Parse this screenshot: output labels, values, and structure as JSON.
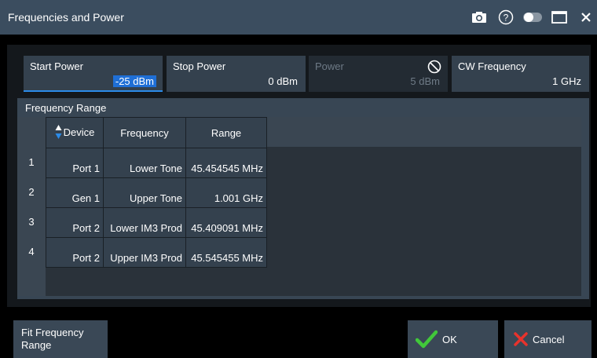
{
  "window": {
    "title": "Frequencies and Power"
  },
  "titlebar_icons": [
    "camera-icon",
    "help-icon",
    "toggle-icon",
    "maximize-icon",
    "close-icon"
  ],
  "fields": {
    "start_power": {
      "label": "Start Power",
      "value": "-25 dBm"
    },
    "stop_power": {
      "label": "Stop Power",
      "value": "0 dBm"
    },
    "power": {
      "label": "Power",
      "value": "5 dBm",
      "disabled": true
    },
    "cw_frequency": {
      "label": "CW Frequency",
      "value": "1 GHz"
    }
  },
  "frequency_range": {
    "title": "Frequency Range",
    "columns": [
      "Device",
      "Frequency",
      "Range"
    ],
    "rows": [
      {
        "num": "1",
        "device": "Port 1",
        "frequency": "Lower Tone",
        "range": "45.454545 MHz"
      },
      {
        "num": "2",
        "device": "Gen 1",
        "frequency": "Upper Tone",
        "range": "1.001 GHz"
      },
      {
        "num": "3",
        "device": "Port 2",
        "frequency": "Lower IM3 Prod",
        "range": "45.409091 MHz"
      },
      {
        "num": "4",
        "device": "Port 2",
        "frequency": "Upper IM3 Prod",
        "range": "45.545455 MHz"
      }
    ]
  },
  "buttons": {
    "fit_frequency_range": "Fit Frequency Range",
    "ok": "OK",
    "cancel": "Cancel"
  },
  "colors": {
    "accent": "#1f6fd6",
    "ok": "#41c83a",
    "cancel": "#e8322c"
  }
}
